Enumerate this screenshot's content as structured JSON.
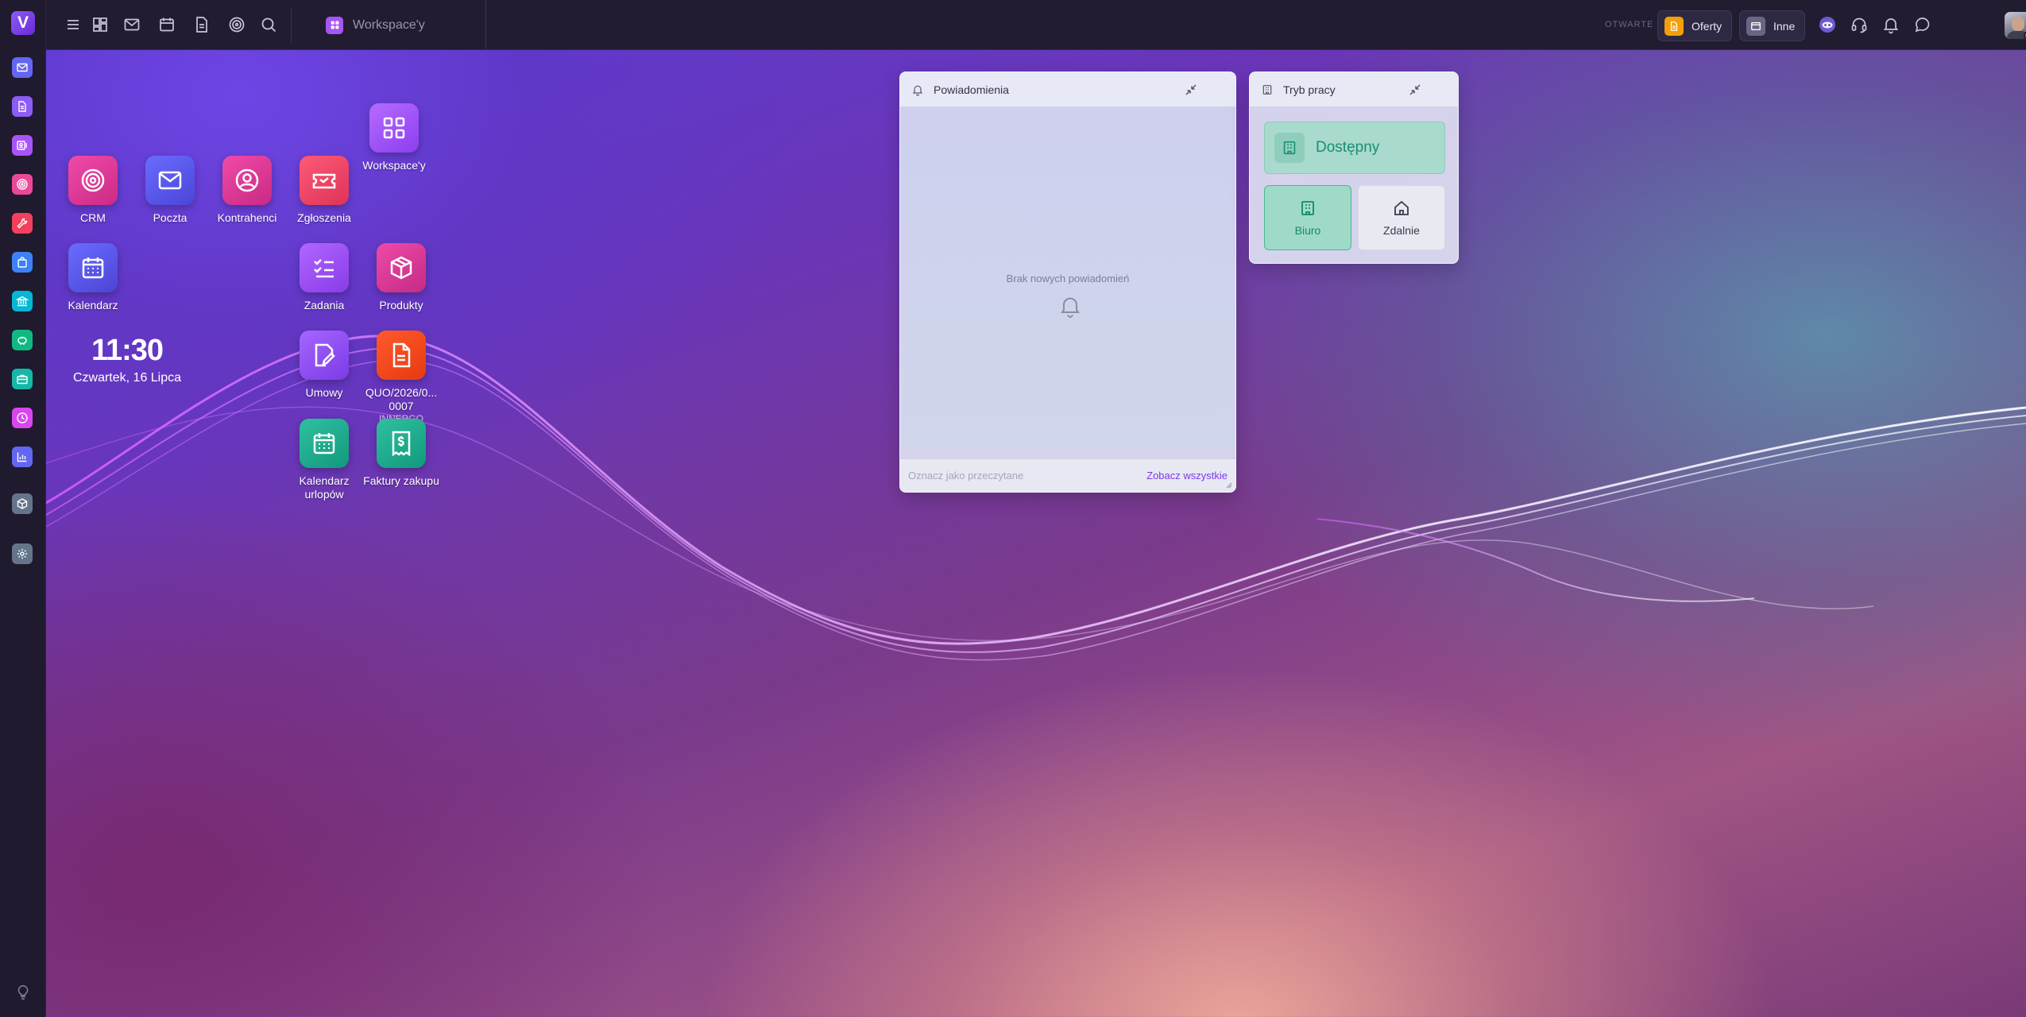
{
  "topbar": {
    "workspace_label": "Workspace'y",
    "open_caption": "OTWARTE",
    "open_tabs": [
      {
        "label": "Oferty",
        "icon": "document-icon",
        "color": "#f59e0b"
      },
      {
        "label": "Inne",
        "icon": "window-icon",
        "color": "#6b6585"
      }
    ],
    "left_icons": [
      "menu-icon",
      "dashboard-icon",
      "mail-icon",
      "calendar-icon",
      "document-icon",
      "target-icon",
      "search-icon"
    ],
    "right_icons": [
      "ai-assistant-icon",
      "headset-icon",
      "bell-icon",
      "chat-icon"
    ]
  },
  "sidebar": {
    "logo": "V",
    "items": [
      {
        "icon": "mail-icon",
        "color": "#6366f1"
      },
      {
        "icon": "document-icon",
        "color": "#8b5cf6"
      },
      {
        "icon": "contacts-icon",
        "color": "#a855f7"
      },
      {
        "icon": "target-icon",
        "color": "#ec4899"
      },
      {
        "icon": "tools-icon",
        "color": "#f43f5e"
      },
      {
        "icon": "bag-icon",
        "color": "#3b82f6"
      },
      {
        "icon": "bank-icon",
        "color": "#06b6d4"
      },
      {
        "icon": "piggy-bank-icon",
        "color": "#10b981"
      },
      {
        "icon": "briefcase-icon",
        "color": "#14b8a6"
      },
      {
        "icon": "clock-icon",
        "color": "#d946ef"
      },
      {
        "icon": "chart-icon",
        "color": "#6366f1"
      },
      {
        "icon": "cube-icon",
        "color": "#64748b"
      },
      {
        "icon": "settings-icon",
        "color": "#64748b"
      }
    ],
    "bottom_icon": "lightbulb-icon"
  },
  "desktop": {
    "apps": [
      {
        "id": "workspaces",
        "label": "Workspace'y",
        "icon": "grid-icon"
      },
      {
        "id": "crm",
        "label": "CRM",
        "icon": "target-icon"
      },
      {
        "id": "poczta",
        "label": "Poczta",
        "icon": "mail-icon"
      },
      {
        "id": "kontrahenci",
        "label": "Kontrahenci",
        "icon": "user-circle-icon"
      },
      {
        "id": "zgloszenia",
        "label": "Zgłoszenia",
        "icon": "ticket-icon"
      },
      {
        "id": "kalendarz",
        "label": "Kalendarz",
        "icon": "calendar-icon"
      },
      {
        "id": "zadania",
        "label": "Zadania",
        "icon": "checklist-icon"
      },
      {
        "id": "produkty",
        "label": "Produkty",
        "icon": "package-icon"
      },
      {
        "id": "umowy",
        "label": "Umowy",
        "icon": "contract-icon"
      },
      {
        "id": "quo",
        "label": "QUO/2026/0... 0007",
        "sublabel": "INNERGO",
        "icon": "document-icon"
      },
      {
        "id": "urlopy",
        "label": "Kalendarz urlopów",
        "icon": "calendar-icon"
      },
      {
        "id": "faktury",
        "label": "Faktury zakupu",
        "icon": "receipt-icon"
      }
    ],
    "clock": {
      "time": "11:30",
      "date": "Czwartek, 16 Lipca"
    }
  },
  "notifications": {
    "title": "Powiadomienia",
    "empty_text": "Brak nowych powiadomień",
    "mark_read": "Oznacz jako przeczytane",
    "see_all": "Zobacz wszystkie"
  },
  "work_mode": {
    "title": "Tryb pracy",
    "status": "Dostępny",
    "options": [
      {
        "label": "Biuro",
        "selected": true
      },
      {
        "label": "Zdalnie",
        "selected": false
      }
    ]
  },
  "colors": {
    "accent": "#7c3aed",
    "available": "#1a8f73"
  }
}
